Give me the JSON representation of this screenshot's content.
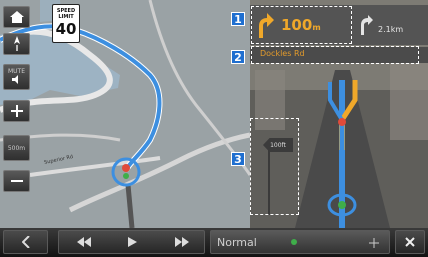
{
  "side_toolbar": {
    "home_icon": "home-icon",
    "compass_icon": "north-compass-icon",
    "mute_label": "MUTE",
    "zoom_in_icon": "plus-icon",
    "scale_label": "500m",
    "zoom_out_icon": "minus-icon"
  },
  "speed_sign": {
    "label_line1": "SPEED",
    "label_line2": "LIMIT",
    "value": "40"
  },
  "map": {
    "road_label": "Superior Rd"
  },
  "guidance": {
    "turn_distance": "100",
    "turn_unit": "m",
    "next_distance": "2.1",
    "next_unit": "km",
    "street_name": "Dockles Rd",
    "distance_marker": "100ft",
    "accent_color": "#f0a82a",
    "route_color": "#3d8fe0"
  },
  "callouts": [
    "1",
    "2",
    "3"
  ],
  "bottom_bar": {
    "back_icon": "back-chevron-icon",
    "rewind_icon": "rewind-icon",
    "play_icon": "play-icon",
    "forward_icon": "fast-forward-icon",
    "mode_label": "Normal",
    "close_icon": "close-icon"
  }
}
